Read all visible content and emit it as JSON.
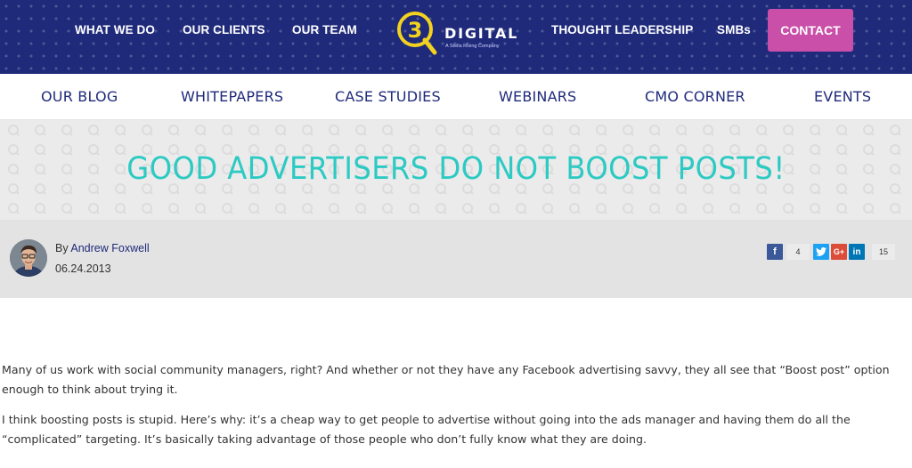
{
  "topnav": {
    "links": [
      {
        "label": "WHAT WE DO"
      },
      {
        "label": "OUR CLIENTS"
      },
      {
        "label": "OUR TEAM"
      },
      {
        "label": "THOUGHT LEADERSHIP"
      },
      {
        "label": "SMBs"
      }
    ],
    "contact_label": "CONTACT",
    "logo": {
      "wordmark": "DIGITAL",
      "tagline": "A Stella Rising Company",
      "mark": "3"
    }
  },
  "subnav": {
    "items": [
      {
        "label": "OUR BLOG"
      },
      {
        "label": "WHITEPAPERS"
      },
      {
        "label": "CASE STUDIES"
      },
      {
        "label": "WEBINARS"
      },
      {
        "label": "CMO CORNER"
      },
      {
        "label": "EVENTS"
      }
    ]
  },
  "hero": {
    "title": "GOOD ADVERTISERS DO NOT BOOST POSTS!"
  },
  "author": {
    "by": "By",
    "name": "Andrew Foxwell",
    "date": "06.24.2013"
  },
  "share": {
    "facebook_icon": "f",
    "facebook_count": "4",
    "googleplus_icon": "G+",
    "linkedin_icon": "in",
    "linkedin_count": "15"
  },
  "article": {
    "paragraphs": [
      "Many of us work with social community managers, right? And whether or not they have any Facebook advertising savvy, they all see that “Boost post” option enough to think about trying it.",
      "I think boosting posts is stupid. Here’s why: it’s a cheap way to get people to advertise without going into the ads manager and having them do all the “complicated” targeting. It’s basically taking advantage of those people who don’t fully know what they are doing."
    ]
  },
  "colors": {
    "nav_bg": "#1f2a7a",
    "contact": "#c94fa8",
    "title": "#2ccac3",
    "logo_yellow": "#f2d21e",
    "facebook": "#3b5998",
    "twitter": "#1da1f2",
    "googleplus": "#dd4b39",
    "linkedin": "#0077b5"
  }
}
